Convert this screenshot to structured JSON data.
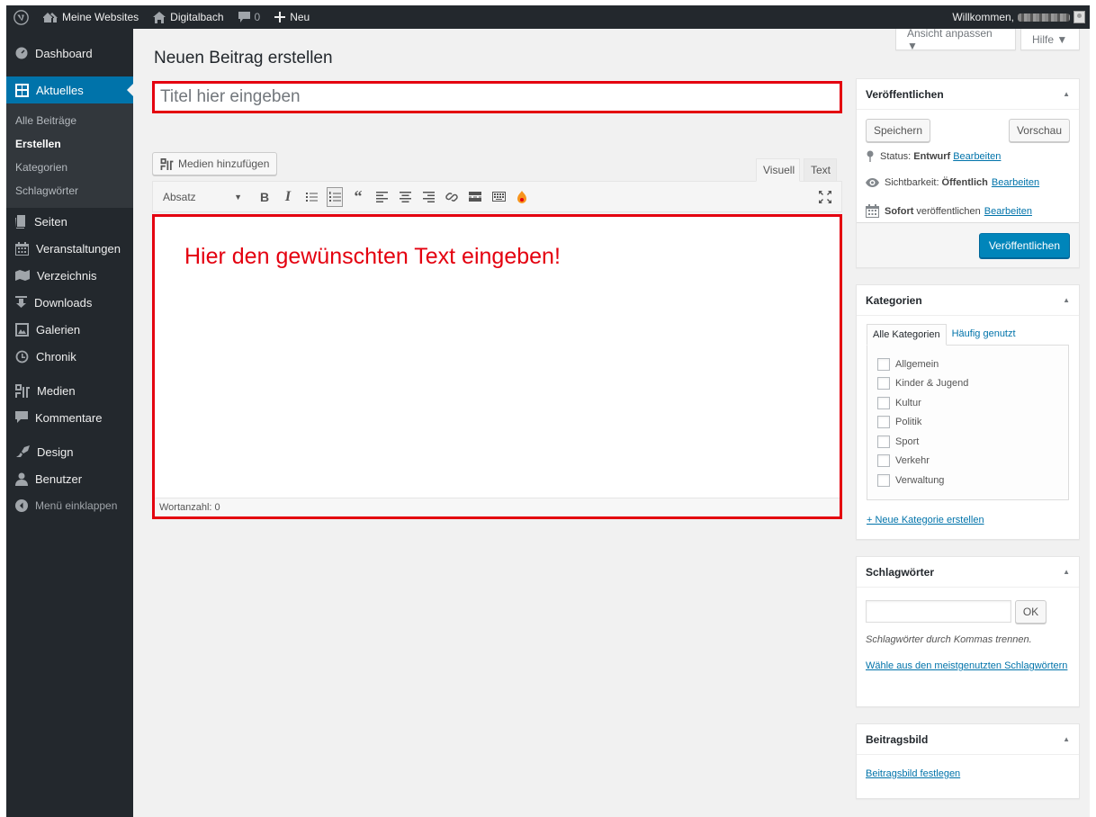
{
  "adminbar": {
    "my_sites": "Meine Websites",
    "site_name": "Digitalbach",
    "comments_count": "0",
    "new_label": "Neu",
    "welcome": "Willkommen,"
  },
  "sidebar": {
    "dashboard": "Dashboard",
    "aktuelles": "Aktuelles",
    "submenu": [
      "Alle Beiträge",
      "Erstellen",
      "Kategorien",
      "Schlagwörter"
    ],
    "seiten": "Seiten",
    "veranstaltungen": "Veranstaltungen",
    "verzeichnis": "Verzeichnis",
    "downloads": "Downloads",
    "galerien": "Galerien",
    "chronik": "Chronik",
    "medien": "Medien",
    "kommentare": "Kommentare",
    "design": "Design",
    "benutzer": "Benutzer",
    "collapse": "Menü einklappen"
  },
  "screen_meta": {
    "options": "Ansicht anpassen ▼",
    "help": "Hilfe ▼"
  },
  "page_title": "Neuen Beitrag erstellen",
  "title_placeholder": "Titel hier eingeben",
  "editor": {
    "add_media": "Medien hinzufügen",
    "tab_visual": "Visuell",
    "tab_text": "Text",
    "format": "Absatz",
    "content": "Hier den gewünschten Text eingeben!",
    "word_count": "Wortanzahl: 0"
  },
  "publish": {
    "title": "Veröffentlichen",
    "save": "Speichern",
    "preview": "Vorschau",
    "status_label": "Status:",
    "status_value": "Entwurf",
    "visibility_label": "Sichtbarkeit:",
    "visibility_value": "Öffentlich",
    "schedule_bold": "Sofort",
    "schedule_text": "veröffentlichen",
    "edit": "Bearbeiten",
    "publish_button": "Veröffentlichen"
  },
  "categories": {
    "title": "Kategorien",
    "tab_all": "Alle Kategorien",
    "tab_popular": "Häufig genutzt",
    "items": [
      "Allgemein",
      "Kinder & Jugend",
      "Kultur",
      "Politik",
      "Sport",
      "Verkehr",
      "Verwaltung"
    ],
    "add_new": "+ Neue Kategorie erstellen"
  },
  "tags": {
    "title": "Schlagwörter",
    "ok": "OK",
    "hint": "Schlagwörter durch Kommas trennen.",
    "choose": "Wähle aus den meistgenutzten Schlagwörtern"
  },
  "featured_image": {
    "title": "Beitragsbild",
    "set": "Beitragsbild festlegen"
  },
  "colors": {
    "adminbar": "#23282d",
    "sidebar": "#23282d",
    "active": "#0073aa",
    "highlight": "#e4000f",
    "background": "#f1f1f1"
  }
}
